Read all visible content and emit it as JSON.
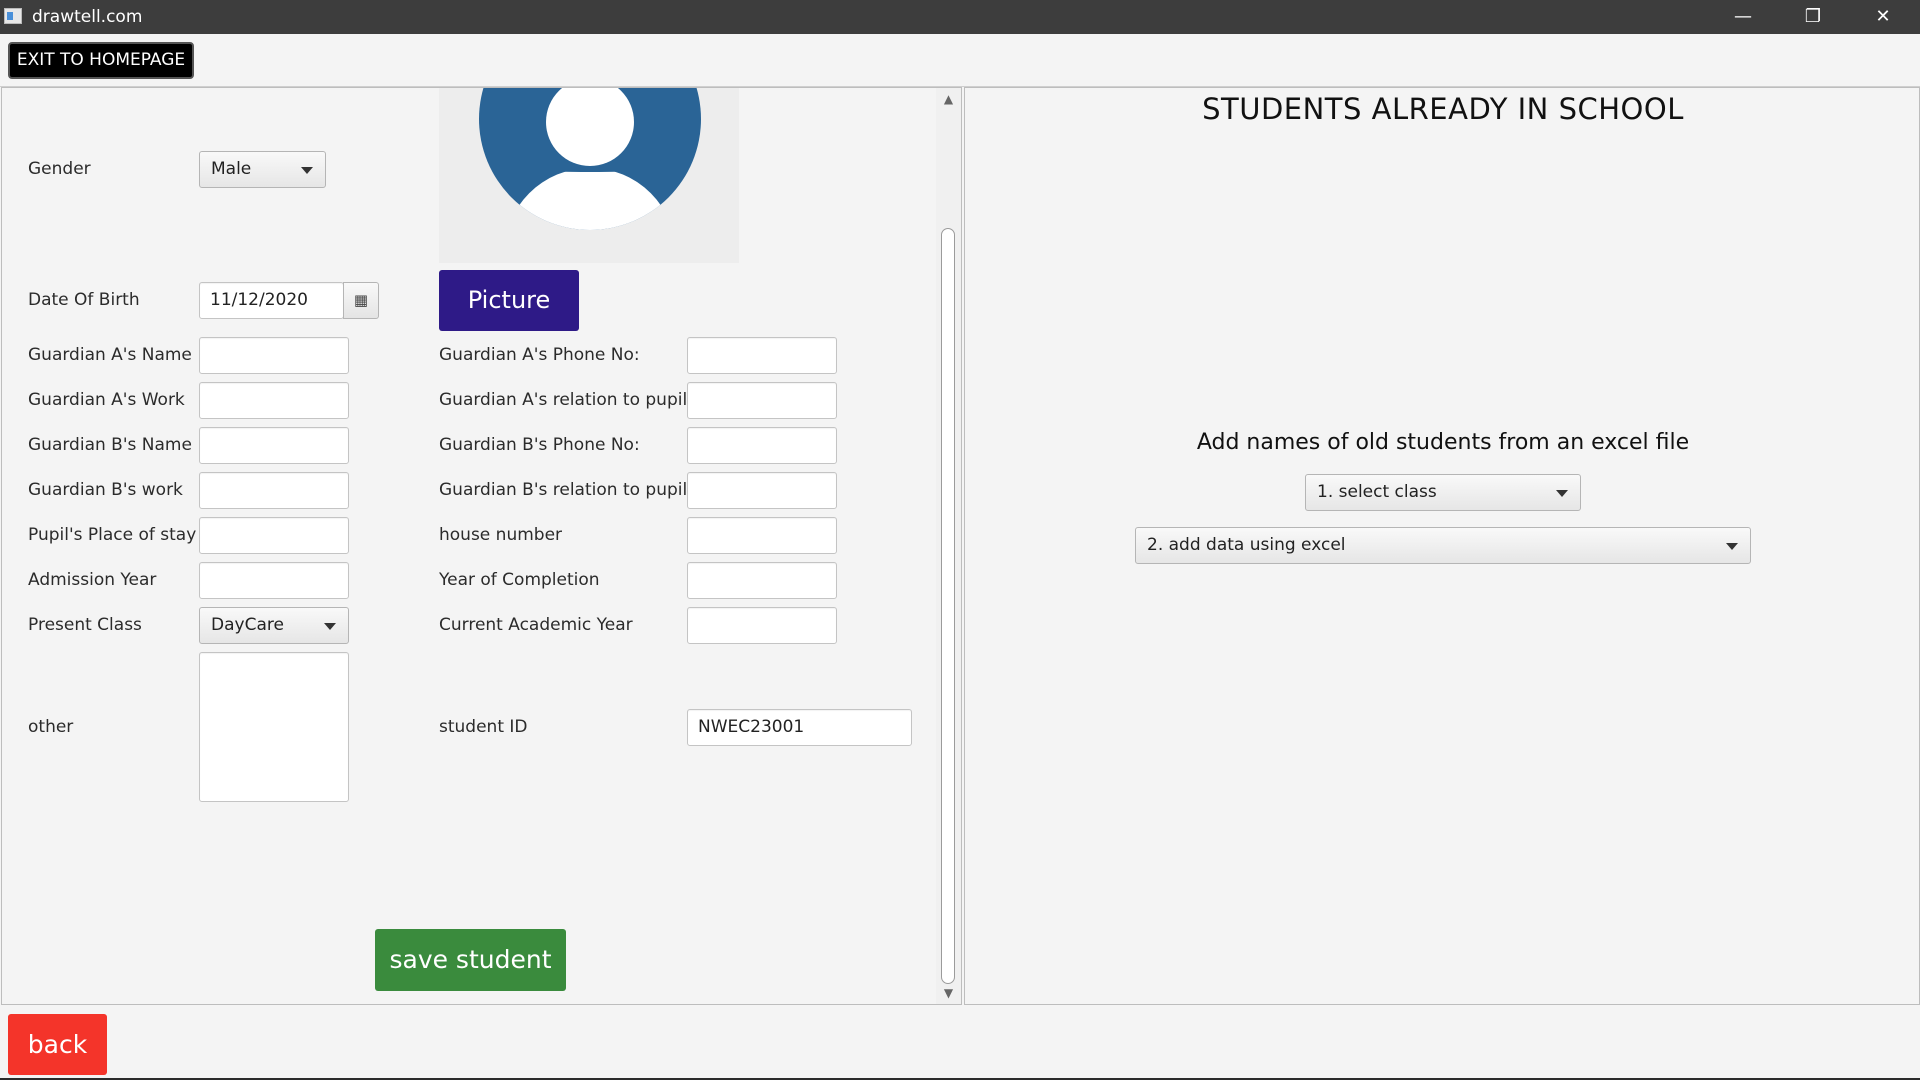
{
  "window": {
    "title": "drawtell.com",
    "minimize_icon": "minimize-icon",
    "restore_icon": "restore-icon",
    "close_icon": "close-icon"
  },
  "toolbar": {
    "exit_label": "EXIT TO HOMEPAGE"
  },
  "form": {
    "gender": {
      "label": "Gender",
      "value": "Male"
    },
    "dob": {
      "label": "Date Of Birth",
      "value": "11/12/2020"
    },
    "picture_button": "Picture",
    "guardian_a_name": {
      "label": "Guardian A's Name",
      "value": ""
    },
    "guardian_a_phone": {
      "label": "Guardian A's Phone No:",
      "value": ""
    },
    "guardian_a_work": {
      "label": "Guardian A's Work",
      "value": ""
    },
    "guardian_a_relation": {
      "label": "Guardian A's relation to pupil",
      "value": ""
    },
    "guardian_b_name": {
      "label": "Guardian B's Name",
      "value": ""
    },
    "guardian_b_phone": {
      "label": "Guardian B's Phone No:",
      "value": ""
    },
    "guardian_b_work": {
      "label": "Guardian B's work",
      "value": ""
    },
    "guardian_b_relation": {
      "label": "Guardian B's relation to pupil",
      "value": ""
    },
    "place_of_stay": {
      "label": "Pupil's Place of stay",
      "value": ""
    },
    "house_number": {
      "label": "house number",
      "value": ""
    },
    "admission_year": {
      "label": "Admission Year",
      "value": ""
    },
    "year_of_completion": {
      "label": "Year of Completion",
      "value": ""
    },
    "present_class": {
      "label": "Present Class",
      "value": "DayCare"
    },
    "current_academic_year": {
      "label": "Current Academic Year",
      "value": ""
    },
    "other": {
      "label": "other",
      "value": ""
    },
    "student_id": {
      "label": "student ID",
      "value": "NWEC23001"
    },
    "save_button": "save student"
  },
  "right": {
    "title": "STUDENTS ALREADY IN SCHOOL",
    "excel_label": "Add names of old students from an excel file",
    "select_class": "1. select class",
    "add_data": "2. add data using excel"
  },
  "bottom": {
    "back_label": "back"
  },
  "colors": {
    "picture_button": "#2e1a87",
    "save_button": "#3a8b3d",
    "back_button": "#f4342a",
    "avatar": "#2a6496"
  }
}
